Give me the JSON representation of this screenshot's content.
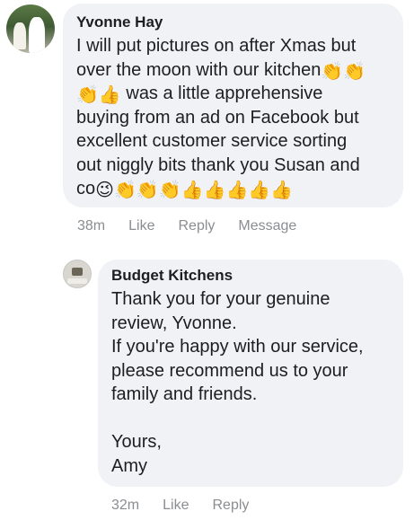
{
  "comments": [
    {
      "author": "Yvonne Hay",
      "text_line1": "I will put pictures on after Xmas but",
      "text_line2": "over the moon with our kitchen",
      "text_line3": " was a little apprehensive",
      "text_line4": "buying from an ad on Facebook but",
      "text_line5": "excellent customer service sorting",
      "text_line6": "out niggly bits thank you Susan and",
      "text_line7": "co",
      "emoji_clap": "👏",
      "emoji_thumb": "👍",
      "emoji_wink": "😉",
      "timestamp": "38m",
      "like_label": "Like",
      "reply_label": "Reply",
      "message_label": "Message"
    },
    {
      "author": "Budget Kitchens",
      "text": "Thank you for your genuine\nreview, Yvonne.\nIf you're happy with our service,\nplease recommend us to your\nfamily and friends.\n\nYours,\nAmy",
      "timestamp": "32m",
      "like_label": "Like",
      "reply_label": "Reply"
    }
  ],
  "colors": {
    "bubble_bg": "#f0f2f5",
    "meta_text": "#8a8d91",
    "body_text": "#1c1e21"
  }
}
